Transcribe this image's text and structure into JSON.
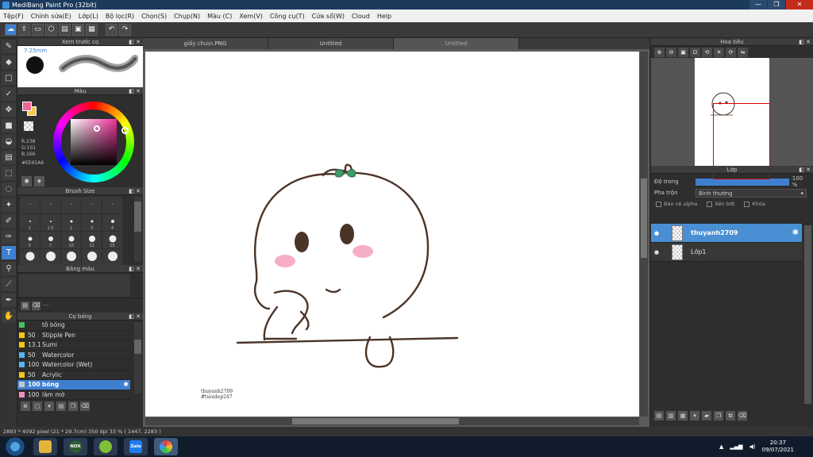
{
  "window": {
    "title": "MediBang Paint Pro (32bit)",
    "btn_min": "—",
    "btn_max": "❐",
    "btn_close": "✕"
  },
  "menu": [
    "Tệp(F)",
    "Chỉnh sửa(E)",
    "Lớp(L)",
    "Bộ lọc(R)",
    "Chọn(S)",
    "Chụp(N)",
    "Màu (C)",
    "Xem(V)",
    "Công cụ(T)",
    "Cửa sổ(W)",
    "Cloud",
    "Help"
  ],
  "toolbar": {
    "undo": "↶",
    "redo": "↷"
  },
  "brush_preview": {
    "header": "Xem trước cọ",
    "size_label": "7.25mm"
  },
  "color_panel": {
    "header": "Màu",
    "fore_color": "#EE6596",
    "back_color": "#F2C94C",
    "r": "R:238",
    "g": "G:101",
    "b": "B:166",
    "hex": "#EE65A6"
  },
  "brush_size": {
    "header": "Brush Size",
    "sizes": [
      "",
      "",
      "",
      "",
      "",
      "1",
      "1.5",
      "2",
      "3",
      "4",
      "5",
      "7",
      "10",
      "12",
      "15",
      "",
      "",
      "",
      "",
      ""
    ]
  },
  "palette": {
    "header": "Bảng màu",
    "dash": "---"
  },
  "brush_list": {
    "header": "Cọ bóng",
    "items": [
      {
        "size": "",
        "name": "tô bóng",
        "color": "#45c45a",
        "selected": false
      },
      {
        "size": "50",
        "name": "Stipple Pen",
        "color": "#f2c811",
        "selected": false
      },
      {
        "size": "13.1",
        "name": "Sumi",
        "color": "#f2c811",
        "selected": false
      },
      {
        "size": "50",
        "name": "Watercolor",
        "color": "#55b7f0",
        "selected": false
      },
      {
        "size": "100",
        "name": "Watercolor (Wet)",
        "color": "#55b7f0",
        "selected": false
      },
      {
        "size": "50",
        "name": "Acrylic",
        "color": "#f2c811",
        "selected": false
      },
      {
        "size": "100",
        "name": "bóng",
        "color": "#c8c8c8",
        "selected": true
      },
      {
        "size": "100",
        "name": "làm mờ",
        "color": "#f090c0",
        "selected": false
      }
    ]
  },
  "tabs": [
    {
      "label": "giấy chu\\n.PNG",
      "active": false
    },
    {
      "label": "Untitled",
      "active": false
    },
    {
      "label": "Untitled",
      "active": true
    }
  ],
  "canvas": {
    "sig_line1": "thuyanh2709",
    "sig_line2": "#tuoidep247"
  },
  "navigator": {
    "header": "Hoa tiêu"
  },
  "layers": {
    "header": "Lớp",
    "opacity_label": "Độ trong",
    "opacity": 1.0,
    "opacity_value": "100 %",
    "blend_label": "Pha trộn",
    "blend_value": "Bình thường",
    "protect_alpha": "Bảo vệ alpha",
    "clipping": "Xén bớt",
    "lock": "Khóa",
    "items": [
      {
        "name": "thuyanh2709",
        "selected": true
      },
      {
        "name": "Lớp1",
        "selected": false
      }
    ]
  },
  "status": {
    "text": "2893 * 4092 pixel  (21 * 29.7cm)  350 dpi  33 %  ( 1447, 2283 )"
  },
  "taskbar": {
    "apps": [
      "NOX",
      "",
      "Zalo",
      ""
    ],
    "time": "20:37",
    "date": "09/07/2021"
  }
}
